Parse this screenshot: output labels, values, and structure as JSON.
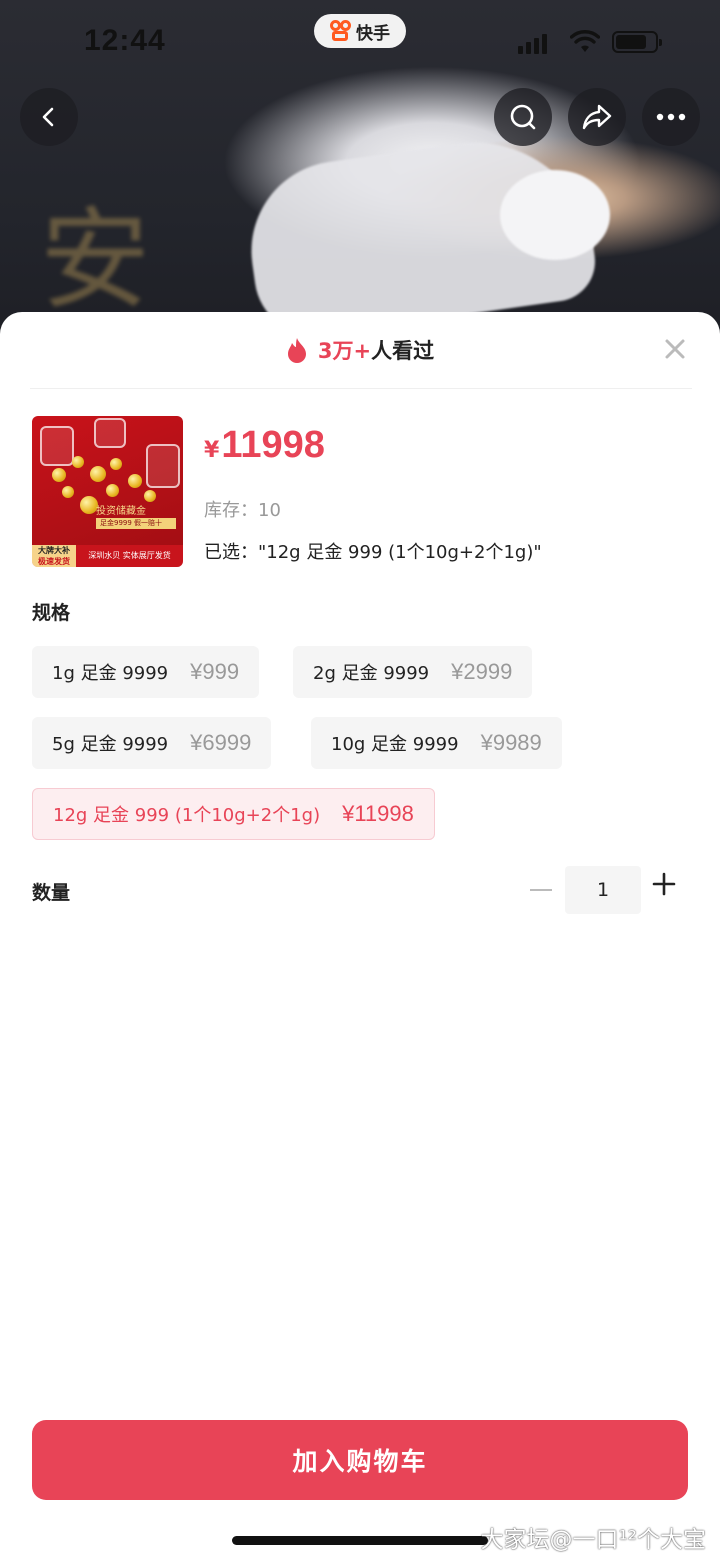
{
  "status_bar": {
    "time": "12:44",
    "app_name": "快手"
  },
  "header": {
    "back_icon": "chevron-left-icon",
    "search_icon": "search-icon",
    "share_icon": "share-icon",
    "more_icon": "more-icon"
  },
  "sheet": {
    "views_count": "3万+",
    "views_suffix": "人看过",
    "product": {
      "thumb_texts": {
        "top": "投资储藏金",
        "strip": "足金9999 假一赔十",
        "left_a": "大牌大补",
        "left_b": "极速发货",
        "right": "深圳水贝 实体展厅发货"
      },
      "currency": "¥",
      "price": "11998",
      "stock": "库存：10",
      "selected": "已选：\"12g 足金 999 (1个10g+2个1g)\""
    },
    "spec_title": "规格",
    "specs": [
      {
        "name": "1g 足金 9999",
        "price": "¥999",
        "selected": false
      },
      {
        "name": "2g 足金 9999",
        "price": "¥2999",
        "selected": false
      },
      {
        "name": "5g 足金 9999",
        "price": "¥6999",
        "selected": false
      },
      {
        "name": "10g 足金 9999",
        "price": "¥9989",
        "selected": false
      },
      {
        "name": "12g 足金 999 (1个10g+2个1g)",
        "price": "¥11998",
        "selected": true
      }
    ],
    "quantity_title": "数量",
    "quantity": "1",
    "add_to_cart": "加入购物车"
  },
  "watermark": "大家坛@一口¹²个大宝",
  "colors": {
    "accent": "#e84457",
    "selected_bg": "#fdeef0",
    "chip_bg": "#f5f5f5"
  }
}
